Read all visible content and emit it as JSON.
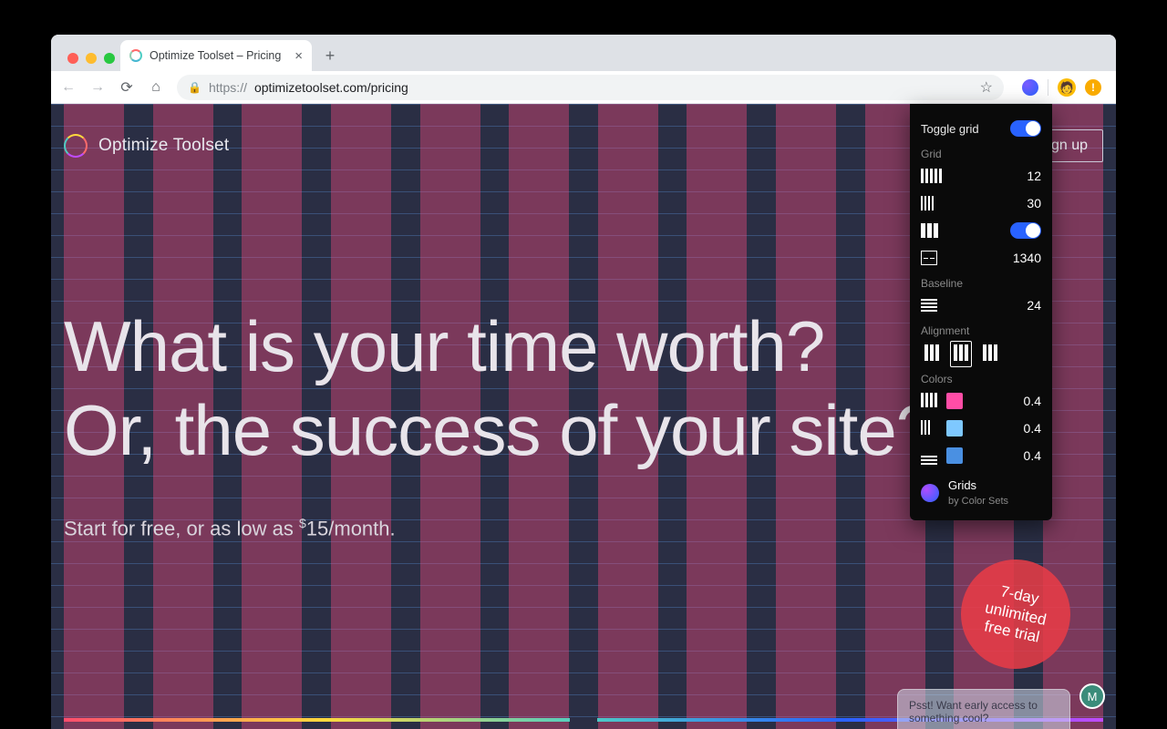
{
  "browser": {
    "tab_title": "Optimize Toolset – Pricing",
    "url_protocol": "https://",
    "url_rest": "optimizetoolset.com/pricing"
  },
  "page": {
    "brand": "Optimize Toolset",
    "signup": "Sign up",
    "headline_line1": "What is your time worth?",
    "headline_line2": "Or, the success of your site?",
    "subtext_prefix": "Start for free, or as low as ",
    "subtext_dollar": "$",
    "subtext_price": "15/month.",
    "trial_line1": "7-day",
    "trial_line2": "unlimited",
    "trial_line3": "free trial",
    "early_line1": "Psst! Want early access to",
    "early_line2": "something cool?",
    "coin_letter": "M"
  },
  "panel": {
    "toggle_label": "Toggle grid",
    "toggle_on": true,
    "section_grid": "Grid",
    "columns": "12",
    "gutter": "30",
    "col_toggle_on": true,
    "max_width": "1340",
    "section_baseline": "Baseline",
    "baseline": "24",
    "section_alignment": "Alignment",
    "align_selected": "center",
    "section_colors": "Colors",
    "color1": {
      "hex": "#ff4da6",
      "alpha": "0.4"
    },
    "color2": {
      "hex": "#7ec8ff",
      "alpha": "0.4"
    },
    "color3": {
      "hex": "#4a90e2",
      "alpha": "0.4"
    },
    "footer_title": "Grids",
    "footer_sub": "by Color Sets"
  }
}
